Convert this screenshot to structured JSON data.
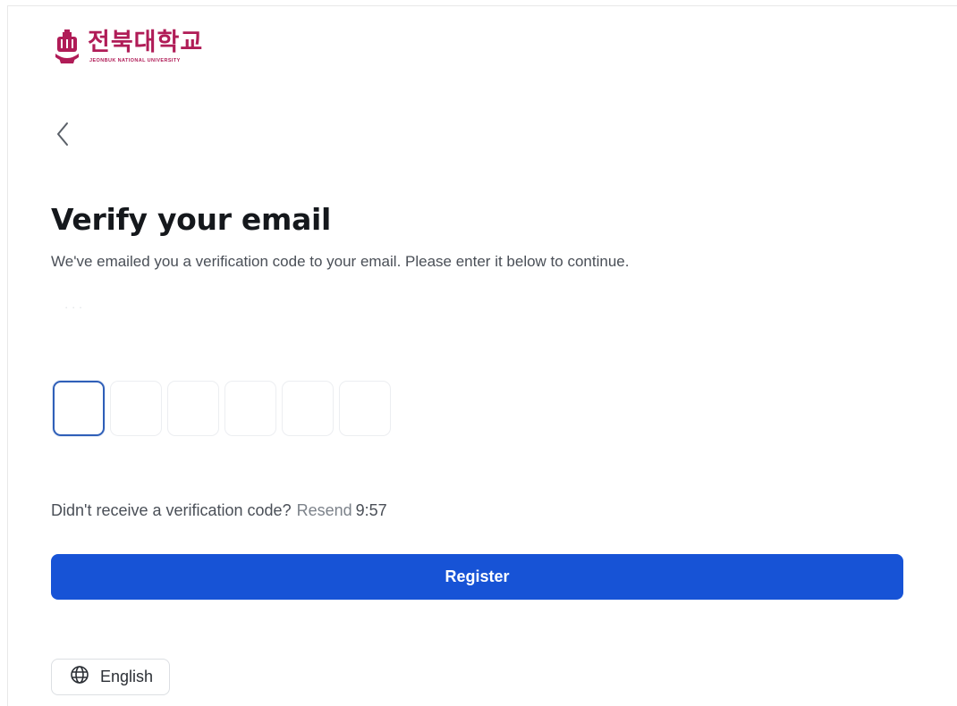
{
  "colors": {
    "brand": "#b01c57",
    "primary": "#1753d6",
    "active_border": "#2f5fb8"
  },
  "logo": {
    "korean": "전북대학교",
    "english": "JEONBUK NATIONAL UNIVERSITY",
    "icon": "university-emblem-icon"
  },
  "nav": {
    "back_icon": "chevron-left-icon"
  },
  "main": {
    "title": "Verify your email",
    "subtitle": "We've emailed you a verification code to your email. Please enter it below to continue.",
    "faint_label": "· · ·"
  },
  "otp": {
    "digits": [
      "",
      "",
      "",
      "",
      "",
      ""
    ],
    "active_index": 0
  },
  "resend": {
    "prompt": "Didn't receive a verification code?",
    "link": "Resend",
    "timer": "9:57"
  },
  "actions": {
    "register_label": "Register"
  },
  "language": {
    "icon": "globe-icon",
    "label": "English"
  }
}
